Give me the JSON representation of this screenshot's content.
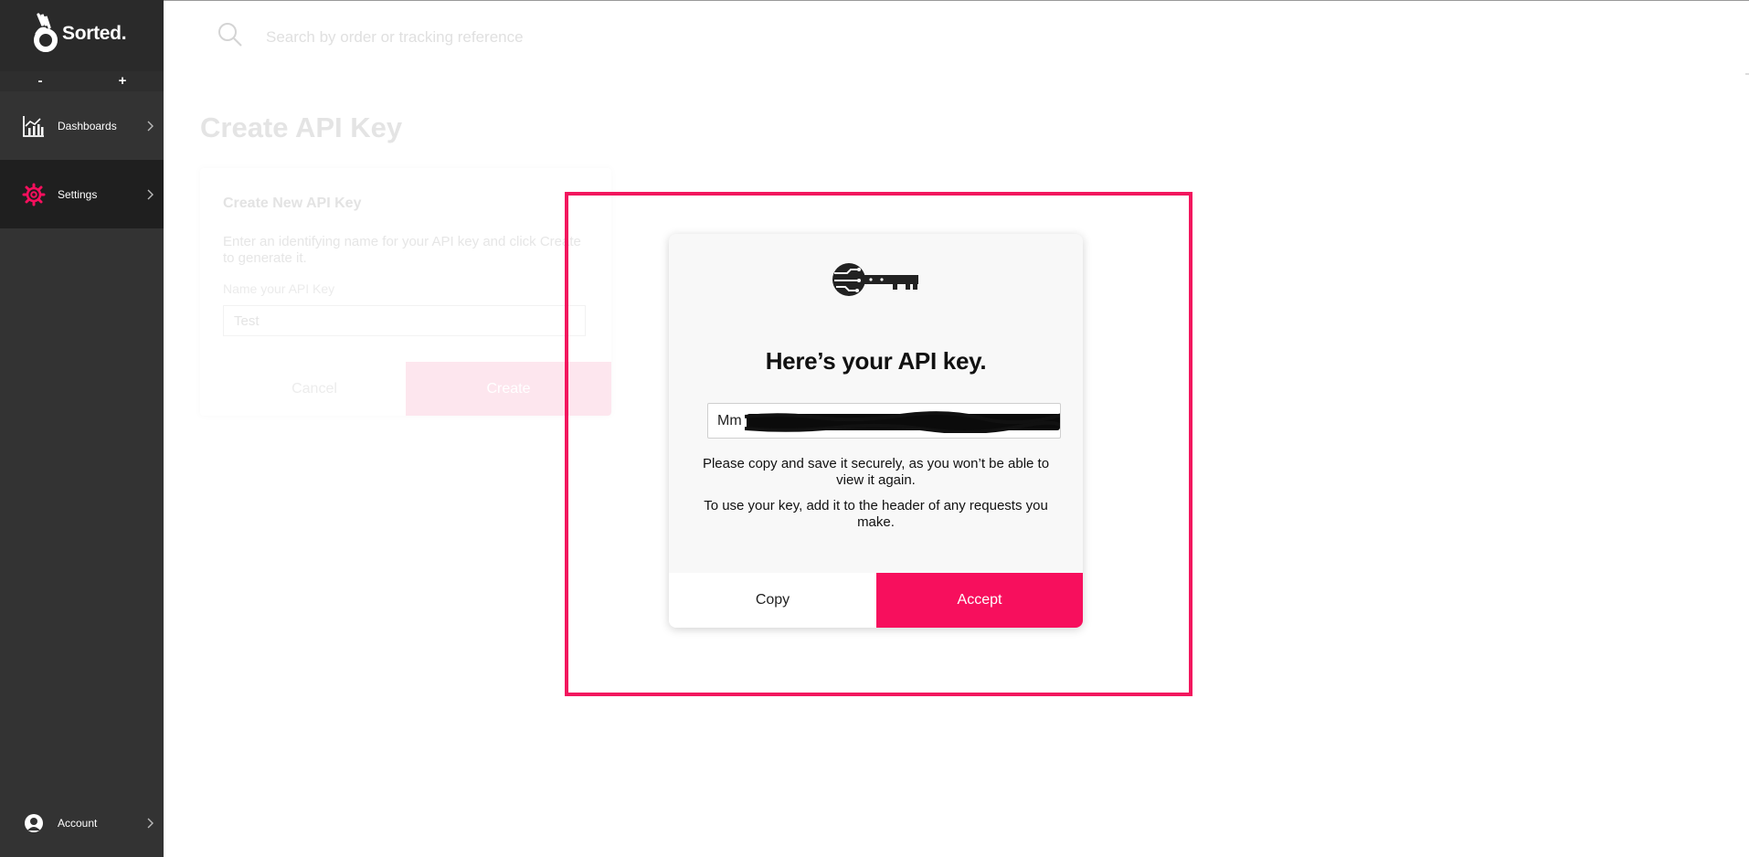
{
  "app": {
    "logo_text": "Sorted."
  },
  "sidebar": {
    "zoom_out": "-",
    "zoom_in": "+",
    "items": [
      {
        "label": "Dashboards",
        "icon": "bar-chart-icon"
      },
      {
        "label": "Settings",
        "icon": "gear-icon",
        "active": true
      },
      {
        "label": "Account",
        "icon": "user-icon"
      }
    ]
  },
  "search": {
    "placeholder": "Search by order or tracking reference"
  },
  "page": {
    "title": "Create API Key",
    "card": {
      "title": "Create New API Key",
      "description": "Enter an identifying name for your API key and click Create to generate it.",
      "name_label": "Name your API Key",
      "name_value": "Test",
      "cancel_label": "Cancel",
      "create_label": "Create"
    }
  },
  "modal": {
    "title": "Here’s your API key.",
    "key_visible_prefix": "Mm",
    "note1": "Please copy and save it securely, as you won’t be able to view it again.",
    "note2": "To use your key, add it to the header of any requests you make.",
    "copy_label": "Copy",
    "accept_label": "Accept"
  },
  "colors": {
    "accent": "#f70f5d",
    "sidebar": "#333333",
    "highlight": "#f2175e"
  }
}
